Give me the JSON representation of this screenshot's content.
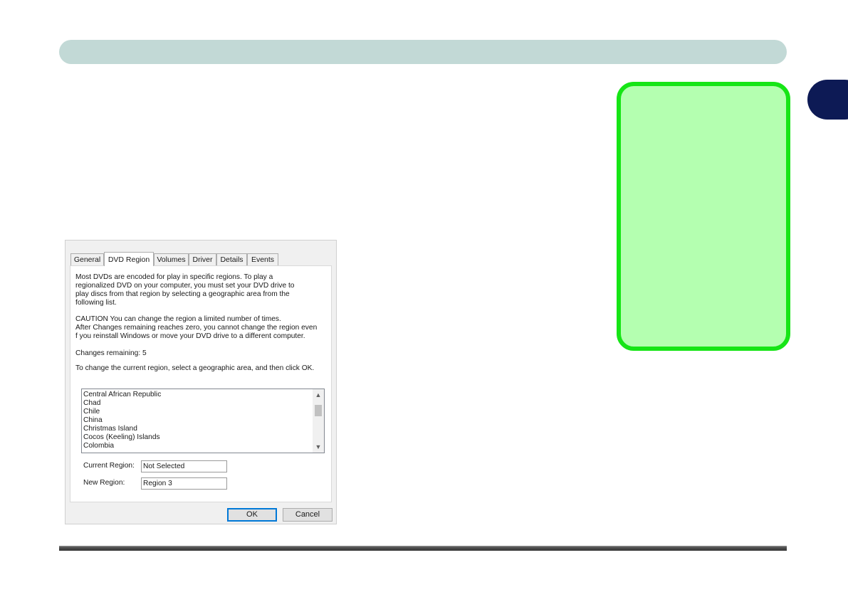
{
  "dialog": {
    "tabs": [
      "General",
      "DVD Region",
      "Volumes",
      "Driver",
      "Details",
      "Events"
    ],
    "active_tab": "DVD Region",
    "intro": "Most DVDs are encoded for play in specific regions. To play a\nregionalized DVD on your computer, you must set your DVD drive to\nplay discs from that region by selecting a geographic area from the\nfollowing list.",
    "caution": "CAUTION  You can change the region a limited number of times.\nAfter Changes remaining reaches zero, you cannot change the region even\nf you reinstall Windows or move your DVD drive to a different computer.",
    "changes_remaining": "Changes remaining: 5",
    "instruction": "To change the current region, select a geographic area, and then click OK.",
    "region_list": [
      "Central African Republic",
      "Chad",
      "Chile",
      "China",
      "Christmas Island",
      "Cocos (Keeling) Islands",
      "Colombia"
    ],
    "current_region_label": "Current Region:",
    "current_region_value": "Not Selected",
    "new_region_label": "New Region:",
    "new_region_value": "Region 3",
    "ok_label": "OK",
    "cancel_label": "Cancel"
  },
  "colors": {
    "header_bar": "#c2d9d6",
    "chapter_tab": "#0d1a55",
    "note_fill": "#b4ffb0",
    "note_border": "#16e516",
    "default_button_border": "#0078d7"
  }
}
